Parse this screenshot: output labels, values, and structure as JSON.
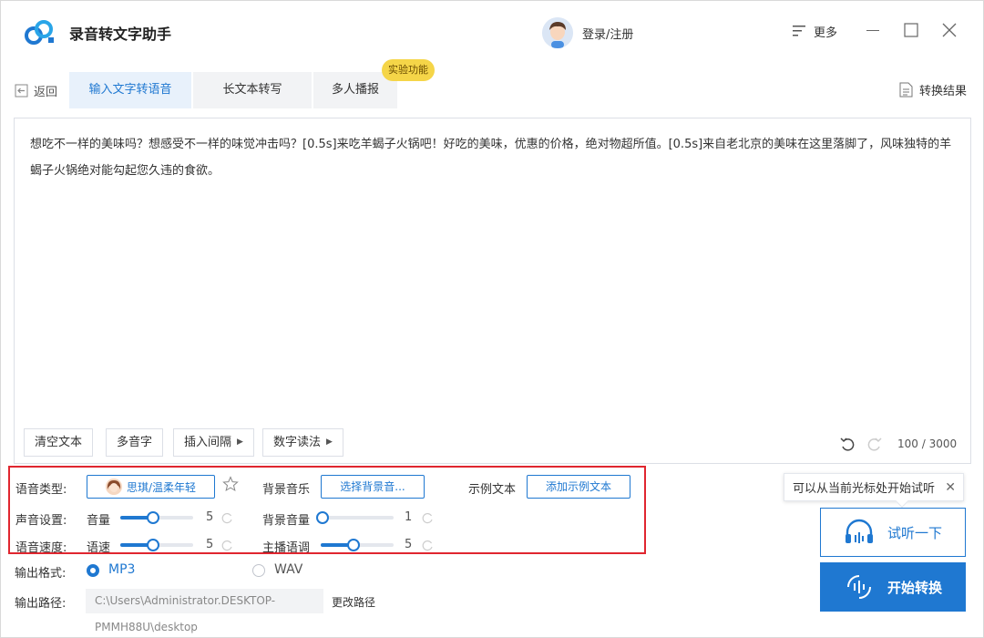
{
  "app": {
    "title": "录音转文字助手"
  },
  "header": {
    "login_label": "登录/注册",
    "more_label": "更多"
  },
  "nav": {
    "back_label": "返回",
    "tabs": [
      {
        "label": "输入文字转语音"
      },
      {
        "label": "长文本转写"
      },
      {
        "label": "多人播报"
      }
    ],
    "badge": "实验功能",
    "result_label": "转换结果"
  },
  "editor": {
    "text": "想吃不一样的美味吗？想感受不一样的味觉冲击吗？[0.5s]来吃羊蝎子火锅吧！好吃的美味，优惠的价格，绝对物超所值。[0.5s]来自老北京的美味在这里落脚了，风味独特的羊蝎子火锅绝对能勾起您久违的食欲。",
    "buttons": {
      "clear": "清空文本",
      "polyphone": "多音字",
      "insert_pause": "插入间隔",
      "number_read": "数字读法"
    },
    "count": "100 / 3000"
  },
  "settings": {
    "voice_type_label": "语音类型:",
    "voice_name": "思琪/温柔年轻",
    "bg_music_label": "背景音乐",
    "bg_music_button": "选择背景音...",
    "sample_label": "示例文本",
    "sample_button": "添加示例文本",
    "sound_label": "声音设置:",
    "volume_label": "音量",
    "volume_value": "5",
    "bg_volume_label": "背景音量",
    "bg_volume_value": "1",
    "speed_label": "语音速度:",
    "rate_label": "语速",
    "rate_value": "5",
    "pitch_label": "主播语调",
    "pitch_value": "5"
  },
  "output": {
    "format_label": "输出格式:",
    "formats": [
      {
        "label": "MP3",
        "selected": true
      },
      {
        "label": "WAV",
        "selected": false
      }
    ],
    "path_label": "输出路径:",
    "path_line1": "C:\\Users\\Administrator.DESKTOP-",
    "path_line2": "PMMH88U\\desktop",
    "change_path": "更改路径"
  },
  "actions": {
    "tooltip": "可以从当前光标处开始试听",
    "listen": "试听一下",
    "convert": "开始转换"
  },
  "colors": {
    "accent": "#1f78d1",
    "highlight_border": "#e0262f",
    "badge": "#f5d548"
  }
}
